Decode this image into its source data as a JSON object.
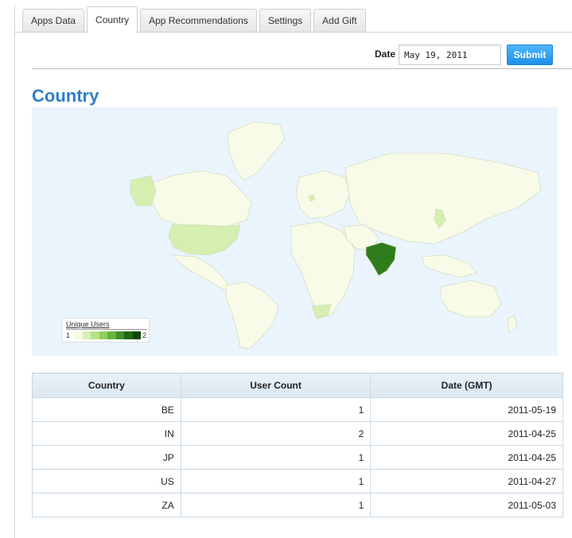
{
  "tabs": [
    {
      "label": "Apps Data"
    },
    {
      "label": "Country",
      "active": true
    },
    {
      "label": "App Recommendations"
    },
    {
      "label": "Settings"
    },
    {
      "label": "Add Gift"
    }
  ],
  "date_form": {
    "label": "Date",
    "value": "May 19, 2011",
    "submit_label": "Submit"
  },
  "page_title": "Country",
  "map": {
    "legend_title": "Unique Users",
    "legend_min": "1",
    "legend_max": "2",
    "scale_colors": [
      "#f4fbe6",
      "#d8f0b4",
      "#b6e285",
      "#8fcf5c",
      "#67b43c",
      "#3f8f24",
      "#1e6a12",
      "#0d4a08"
    ],
    "colors": {
      "ocean": "#eaf4fd",
      "land": "#f7fbe8",
      "border": "#d5dcc0",
      "value_1": "#d4efb0",
      "value_2": "#2f7d1a"
    },
    "highlighted_countries": [
      {
        "code": "IN",
        "users": 2
      },
      {
        "code": "US",
        "users": 1
      },
      {
        "code": "JP",
        "users": 1
      },
      {
        "code": "ZA",
        "users": 1
      },
      {
        "code": "BE",
        "users": 1
      }
    ]
  },
  "table": {
    "headers": [
      "Country",
      "User Count",
      "Date (GMT)"
    ],
    "rows": [
      [
        "BE",
        "1",
        "2011-05-19"
      ],
      [
        "IN",
        "2",
        "2011-04-25"
      ],
      [
        "JP",
        "1",
        "2011-04-25"
      ],
      [
        "US",
        "1",
        "2011-04-27"
      ],
      [
        "ZA",
        "1",
        "2011-05-03"
      ]
    ]
  }
}
